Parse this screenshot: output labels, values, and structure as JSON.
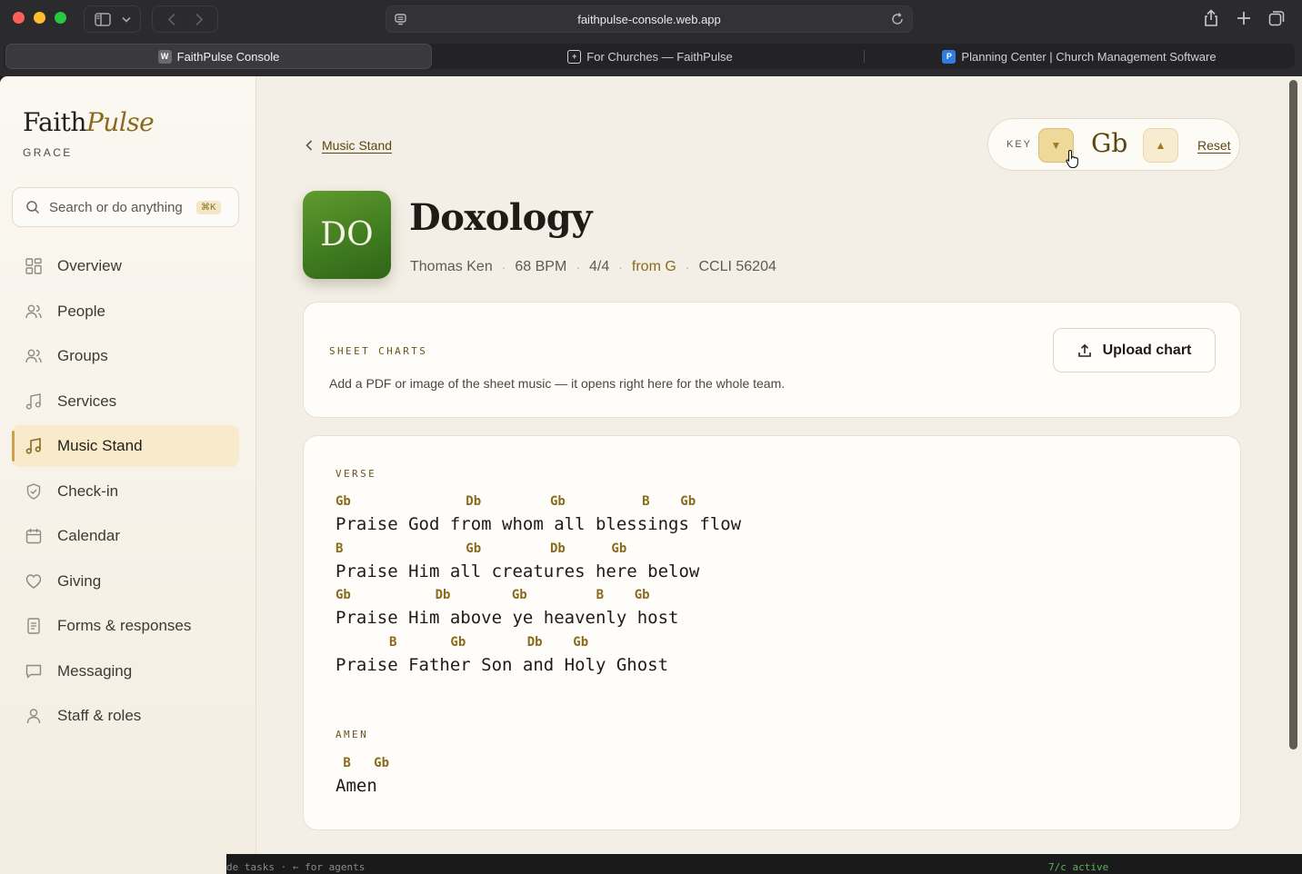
{
  "browser": {
    "url": "faithpulse-console.web.app",
    "tabs": [
      {
        "title": "FaithPulse Console",
        "favicon": "W"
      },
      {
        "title": "For Churches — FaithPulse",
        "favicon": "+"
      },
      {
        "title": "Planning Center | Church Management Software",
        "favicon": "P"
      }
    ]
  },
  "sidebar": {
    "brand_main": "Faith",
    "brand_accent": "Pulse",
    "org": "GRACE",
    "search_placeholder": "Search or do anything",
    "search_shortcut": "⌘K",
    "items": [
      {
        "label": "Overview",
        "icon": "grid-icon"
      },
      {
        "label": "People",
        "icon": "people-icon"
      },
      {
        "label": "Groups",
        "icon": "groups-icon"
      },
      {
        "label": "Services",
        "icon": "music-note-icon"
      },
      {
        "label": "Music Stand",
        "icon": "music-note-icon",
        "active": true
      },
      {
        "label": "Check-in",
        "icon": "shield-check-icon"
      },
      {
        "label": "Calendar",
        "icon": "calendar-icon"
      },
      {
        "label": "Giving",
        "icon": "heart-icon"
      },
      {
        "label": "Forms & responses",
        "icon": "form-icon"
      },
      {
        "label": "Messaging",
        "icon": "message-icon"
      },
      {
        "label": "Staff & roles",
        "icon": "person-icon"
      }
    ]
  },
  "main": {
    "back_label": "Music Stand",
    "key": {
      "label": "KEY",
      "value": "Gb",
      "reset_label": "Reset",
      "down_glyph": "▼",
      "up_glyph": "▲"
    },
    "song": {
      "initials": "DO",
      "title": "Doxology",
      "author": "Thomas Ken",
      "bpm": "68 BPM",
      "time_signature": "4/4",
      "original_key": "from G",
      "ccli": "CCLI 56204",
      "separator": "·"
    },
    "sheet_charts": {
      "title": "SHEET CHARTS",
      "description": "Add a PDF or image of the sheet music — it opens right here for the whole team.",
      "upload_label": "Upload chart"
    },
    "chart": {
      "verse_label": "VERSE",
      "verse": [
        {
          "chords": "Gb               Db         Gb          B    Gb",
          "lyric": "Praise God from whom all blessings flow"
        },
        {
          "chords": "B                Gb         Db      Gb",
          "lyric": "Praise Him all creatures here below"
        },
        {
          "chords": "Gb           Db        Gb         B    Gb",
          "lyric": "Praise Him above ye heavenly host"
        },
        {
          "chords": "       B       Gb        Db    Gb",
          "lyric": "Praise Father Son and Holy Ghost"
        }
      ],
      "amen_label": "AMEN",
      "amen": [
        {
          "chords": " B   Gb",
          "lyric": "Amen"
        }
      ]
    }
  },
  "terminal_peek": {
    "left_text": "de tasks · ← for agents",
    "right_text": "7/c active"
  },
  "colors": {
    "accent": "#8a6b1d",
    "active_bg": "#f7ebcb",
    "page_bg": "#f4efe6",
    "art_green": "#4a8a24"
  }
}
